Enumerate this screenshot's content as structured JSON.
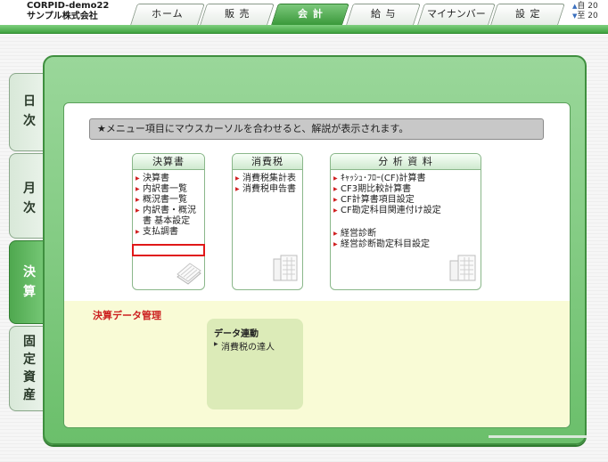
{
  "header": {
    "company_code": "CORPID-demo22",
    "company_name": "サンプル株式会社",
    "tabs": [
      {
        "label": "ホーム"
      },
      {
        "label": "販 売"
      },
      {
        "label": "会 計",
        "active": true
      },
      {
        "label": "給 与"
      },
      {
        "label": "マイナンバー"
      },
      {
        "label": "設 定"
      }
    ],
    "date_from_prefix": "自 20",
    "date_to_prefix": "至 20"
  },
  "side_tabs": [
    {
      "label_lines": [
        "日",
        "次"
      ]
    },
    {
      "label_lines": [
        "月",
        "次"
      ]
    },
    {
      "label_lines": [
        "決",
        "算"
      ],
      "active": true
    },
    {
      "label_lines": [
        "固",
        "定",
        "資",
        "産"
      ]
    }
  ],
  "notice": "★メニュー項目にマウスカーソルを合わせると、解説が表示されます。",
  "panels": {
    "kessansho": {
      "title": "決算書",
      "items": [
        "決算書",
        "内訳書一覧",
        "概況書一覧",
        "内訳書・概況書 基本設定",
        "支払調書"
      ],
      "highlighted": "支払調書"
    },
    "shohizei": {
      "title": "消費税",
      "items": [
        "消費税集計表",
        "消費税申告書"
      ]
    },
    "bunseki": {
      "title": "分 析 資 料",
      "items": [
        "ｷｬｯｼｭ･ﾌﾛｰ(CF)計算書",
        "CF3期比較計算書",
        "CF計算書項目設定",
        "CF勘定科目関連付け設定",
        "経営診断",
        "経営診断勘定科目設定"
      ]
    }
  },
  "kessan_data": {
    "section_label": "決算データ管理",
    "sub_title": "データ連動",
    "sub_item": "消費税の達人"
  },
  "colors": {
    "accent_green": "#4fa84f",
    "highlight_red": "#e01818",
    "section_red": "#cc2020",
    "yellow_area": "#f9fbd6"
  }
}
